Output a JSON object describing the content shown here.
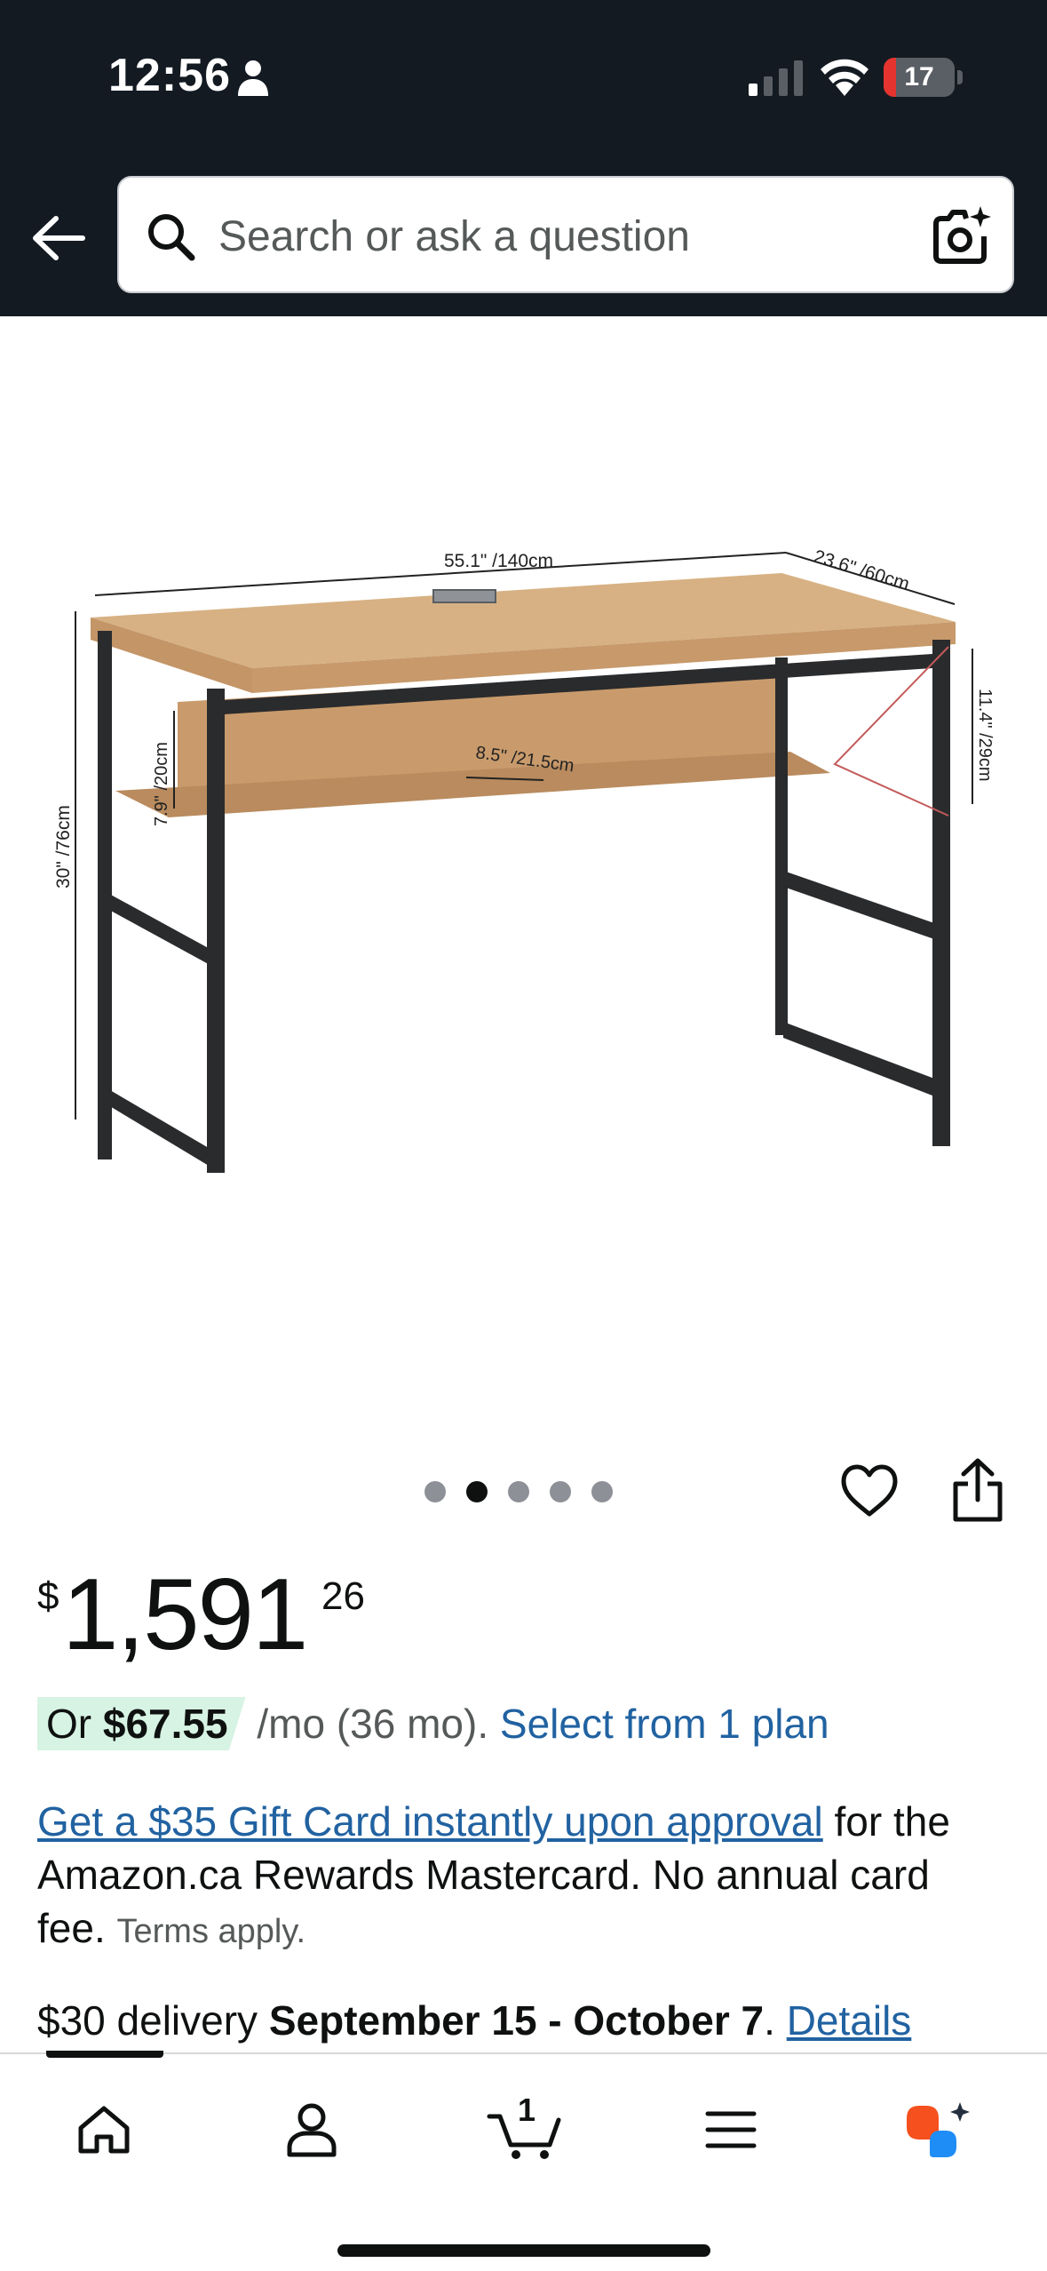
{
  "status_bar": {
    "time": "12:56",
    "battery_level": "17",
    "battery_fraction": 0.17,
    "battery_color": "#e5342f"
  },
  "header": {
    "search_placeholder": "Search or ask a question",
    "background_color": "#131a22"
  },
  "product_image": {
    "dimension_labels": {
      "width": "55.1\" /140cm",
      "depth": "23.6\" /60cm",
      "height": "30\" /76cm",
      "shelf_height": "7.9\" /20cm",
      "shelf_depth": "8.5\" /21.5cm",
      "side_height": "11.4\" /29cm"
    },
    "carousel": {
      "total": 5,
      "active_index": 1
    }
  },
  "price": {
    "currency_symbol": "$",
    "whole": "1,591",
    "fraction": "26"
  },
  "financing": {
    "prefix": "Or ",
    "amount": "$67.55",
    "term": " /mo (36 mo). ",
    "plan_link": "Select from 1 plan",
    "highlight_color": "#d7f3e3"
  },
  "gift_card": {
    "link": "Get a $35 Gift Card instantly upon approval",
    "text": " for the Amazon.ca Rewards Mastercard. No annual card fee. ",
    "terms": "Terms apply."
  },
  "delivery": {
    "prefix": "$30 delivery ",
    "dates": "September 15 - October 7",
    "separator": ". ",
    "details_link": "Details"
  },
  "bottom_nav": {
    "items": [
      "home-icon",
      "account-icon",
      "cart-icon",
      "menu-icon",
      "rufus-ai-icon"
    ],
    "cart_count": "1",
    "link_color": "#2162a1",
    "ai_colors": [
      "#f5501e",
      "#1e8df5"
    ]
  }
}
